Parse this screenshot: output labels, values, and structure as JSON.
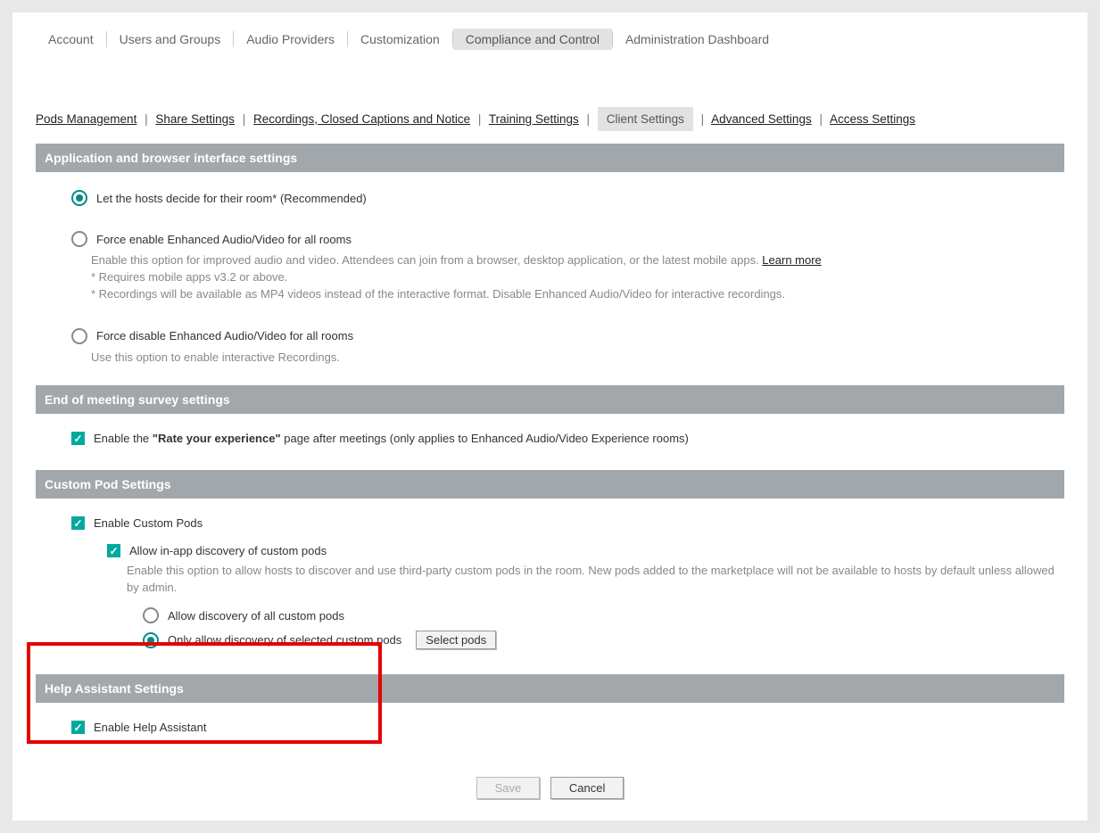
{
  "topnav": {
    "items": [
      "Account",
      "Users and Groups",
      "Audio Providers",
      "Customization",
      "Compliance and Control",
      "Administration Dashboard"
    ],
    "active_index": 4
  },
  "subnav": {
    "items": [
      "Pods Management",
      "Share Settings",
      "Recordings, Closed Captions and Notice",
      "Training Settings",
      "Client Settings",
      "Advanced Settings",
      "Access Settings"
    ],
    "active_index": 4
  },
  "sections": {
    "app_browser": {
      "title": "Application and browser interface settings",
      "opt_host": "Let the hosts decide for their room* (Recommended)",
      "opt_force_enable": "Force enable Enhanced Audio/Video for all rooms",
      "force_enable_desc1": "Enable this option for improved audio and video. Attendees can join from a browser, desktop application, or the latest mobile apps. ",
      "learn_more": "Learn more",
      "force_enable_desc2": "* Requires mobile apps v3.2 or above.",
      "force_enable_desc3": "* Recordings will be available as MP4 videos instead of the interactive format. Disable Enhanced Audio/Video for interactive recordings.",
      "opt_force_disable": "Force disable Enhanced Audio/Video for all rooms",
      "force_disable_desc": "Use this option to enable interactive Recordings."
    },
    "survey": {
      "title": "End of meeting survey settings",
      "enable_prefix": "Enable the ",
      "enable_bold": "\"Rate your experience\"",
      "enable_suffix": " page after meetings (only applies to Enhanced Audio/Video Experience rooms)"
    },
    "custom_pod": {
      "title": "Custom Pod Settings",
      "enable_custom": "Enable Custom Pods",
      "allow_discovery": "Allow in-app discovery of custom pods",
      "discovery_desc": "Enable this option to allow hosts to discover and use third-party custom pods in the room. New pods added to the marketplace will not be available to hosts by default unless allowed by admin.",
      "allow_all": "Allow discovery of all custom pods",
      "only_selected": "Only allow discovery of selected custom pods",
      "select_pods_btn": "Select pods"
    },
    "help": {
      "title": "Help Assistant Settings",
      "enable_help": "Enable Help Assistant"
    }
  },
  "buttons": {
    "save": "Save",
    "cancel": "Cancel"
  }
}
